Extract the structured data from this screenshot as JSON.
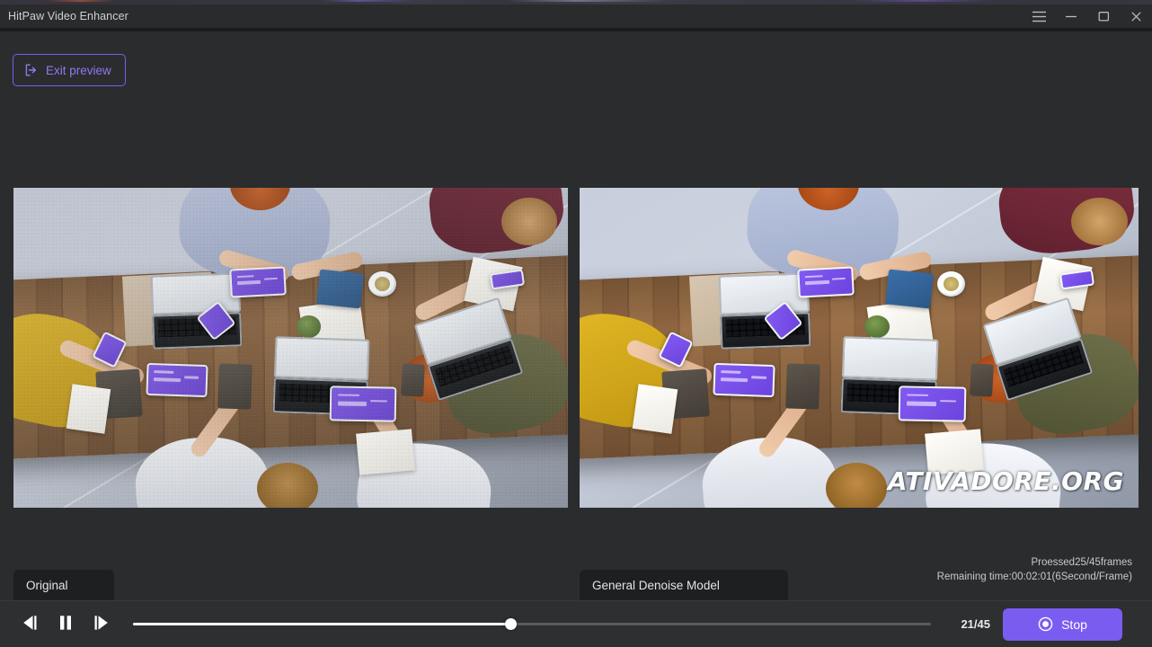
{
  "window": {
    "title": "HitPaw Video Enhancer",
    "controls": [
      {
        "name": "menu-button",
        "icon": "hamburger-icon",
        "label": "Menu"
      },
      {
        "name": "minimize-button",
        "icon": "minimize-icon",
        "label": "Minimize"
      },
      {
        "name": "maximize-button",
        "icon": "maximize-icon",
        "label": "Maximize"
      },
      {
        "name": "close-button",
        "icon": "close-icon",
        "label": "Close"
      }
    ]
  },
  "toolbar": {
    "exit_preview_label": "Exit preview",
    "exit_preview_icon": "exit-icon"
  },
  "preview": {
    "left": {
      "label": "Original"
    },
    "right": {
      "label": "General Denoise Model",
      "watermark": "ATIVADORE.ORG"
    }
  },
  "status": {
    "processed": "Proessed25/45frames",
    "remaining": "Remaining time:00:02:01(6Second/Frame)"
  },
  "transport": {
    "prev_frame_label": "Previous frame",
    "prev_frame_icon": "step-back-icon",
    "pause_label": "Pause",
    "pause_icon": "pause-icon",
    "next_frame_label": "Next frame",
    "next_frame_icon": "step-forward-icon",
    "frame_counter": "21/45",
    "seek_percent": 47.3,
    "stop_label": "Stop",
    "stop_icon": "record-stop-icon"
  },
  "colors": {
    "accent": "#7b5cf0",
    "accent_text": "#8f79f2",
    "window_bg": "#2b2c2e",
    "titlebar_bg": "#2a2b2d",
    "bottombar_bg": "#2e2f31",
    "label_bg": "#1e1f21",
    "text_primary": "#e3e4e6",
    "text_secondary": "#c8c9cb"
  }
}
